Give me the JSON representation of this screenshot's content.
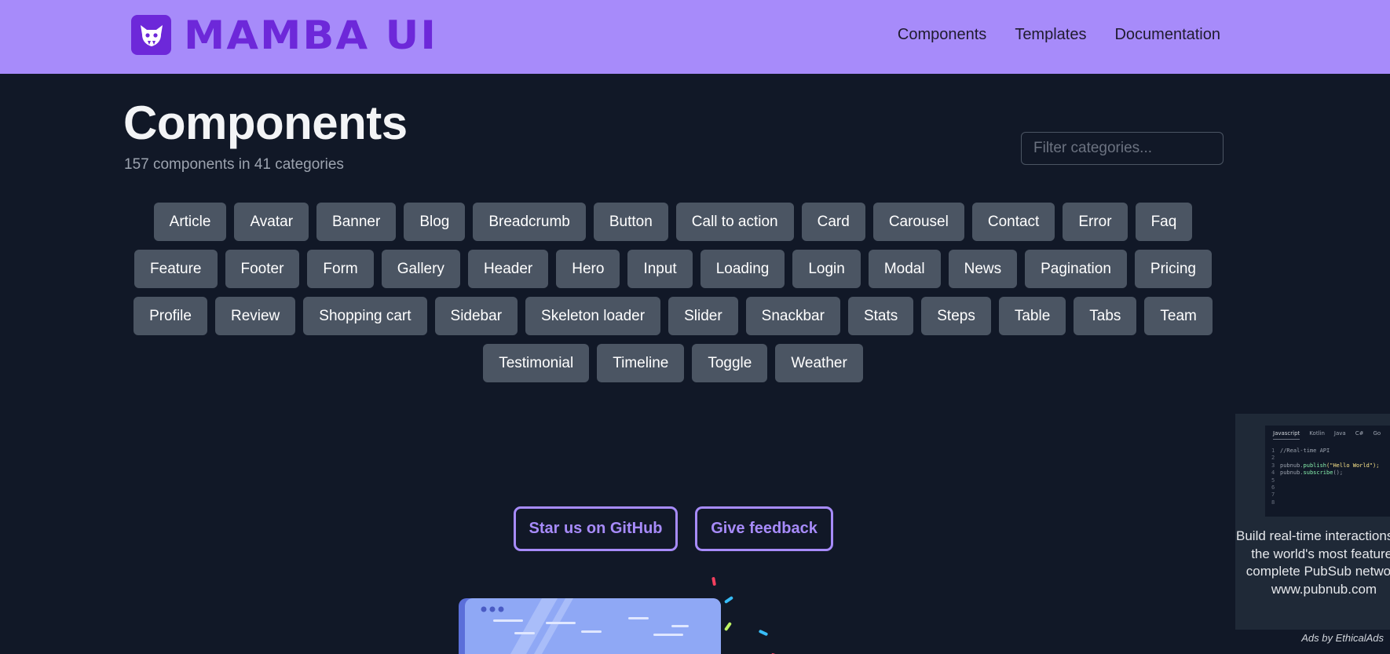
{
  "brand": {
    "name": "MAMBA UI",
    "color": "#6d28d9",
    "header_bg": "#a78bfa"
  },
  "nav": {
    "items": [
      "Components",
      "Templates",
      "Documentation"
    ]
  },
  "main": {
    "title": "Components",
    "subtitle": "157 components in 41 categories",
    "filter_placeholder": "Filter categories..."
  },
  "categories": [
    "Article",
    "Avatar",
    "Banner",
    "Blog",
    "Breadcrumb",
    "Button",
    "Call to action",
    "Card",
    "Carousel",
    "Contact",
    "Error",
    "Faq",
    "Feature",
    "Footer",
    "Form",
    "Gallery",
    "Header",
    "Hero",
    "Input",
    "Loading",
    "Login",
    "Modal",
    "News",
    "Pagination",
    "Pricing",
    "Profile",
    "Review",
    "Shopping cart",
    "Sidebar",
    "Skeleton loader",
    "Slider",
    "Snackbar",
    "Stats",
    "Steps",
    "Table",
    "Tabs",
    "Team",
    "Testimonial",
    "Timeline",
    "Toggle",
    "Weather"
  ],
  "cta": {
    "github": "Star us on GitHub",
    "feedback": "Give feedback"
  },
  "ad": {
    "tabs": [
      "Javascript",
      "Kotlin",
      "Java",
      "C#",
      "Go"
    ],
    "code": {
      "comment": "//Real-time API",
      "publish_obj": "pubnub.",
      "publish_fn": "publish",
      "publish_arg": "(\"Hello World\");",
      "subscribe_obj": "pubnub.",
      "subscribe_fn": "subscribe",
      "subscribe_arg": "();"
    },
    "text": "Build real-time interactions on the world's most feature-complete PubSub network www.pubnub.com",
    "credit": "Ads by EthicalAds"
  }
}
